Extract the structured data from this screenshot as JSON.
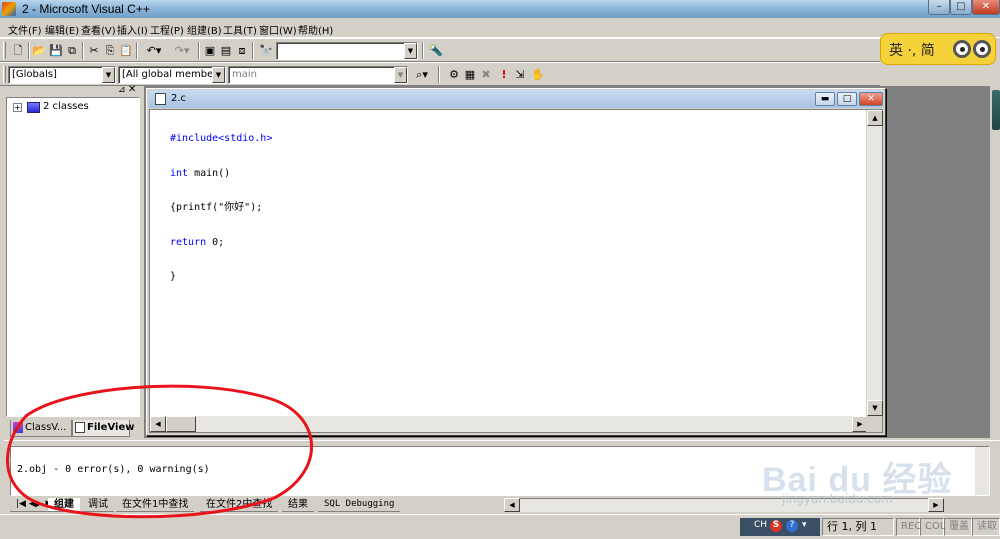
{
  "window": {
    "title": "2 - Microsoft Visual C++",
    "minimize": "–",
    "maximize": "□",
    "close": "✕"
  },
  "menu": [
    "文件(F)",
    "编辑(E)",
    "查看(V)",
    "插入(I)",
    "工程(P)",
    "组建(B)",
    "工具(T)",
    "窗口(W)",
    "帮助(H)"
  ],
  "toolbar": {
    "find_combo_value": "",
    "class_combo": "[Globals]",
    "members_combo": "[All global members",
    "function_combo": "main"
  },
  "ime": {
    "text": "英 ·, 简"
  },
  "workspace": {
    "tree_root": "2 classes",
    "tabs": [
      "ClassV...",
      "FileView"
    ]
  },
  "editor": {
    "title": "2.c",
    "code_lines": [
      "#include<stdio.h>",
      "int main()",
      "{printf(\"你好\");",
      "return 0;",
      "}"
    ]
  },
  "output": {
    "text": "2.obj - 0 error(s), 0 warning(s)",
    "tabs": [
      "组建",
      "调试",
      "在文件1中查找",
      "在文件2中查找",
      "结果",
      "SQL Debugging"
    ]
  },
  "watermark": {
    "logo": "Bai du 经验",
    "url": "jingyan.baidu.com"
  },
  "status": {
    "tray": "CH",
    "position": "行 1, 列 1",
    "rec": "REC",
    "col": "COL",
    "ovr": "覆盖",
    "read": "读取"
  },
  "colors": {
    "annotation": "#e8141c",
    "keyword": "#0000ff",
    "title_gradient": "#8fb7d9"
  }
}
